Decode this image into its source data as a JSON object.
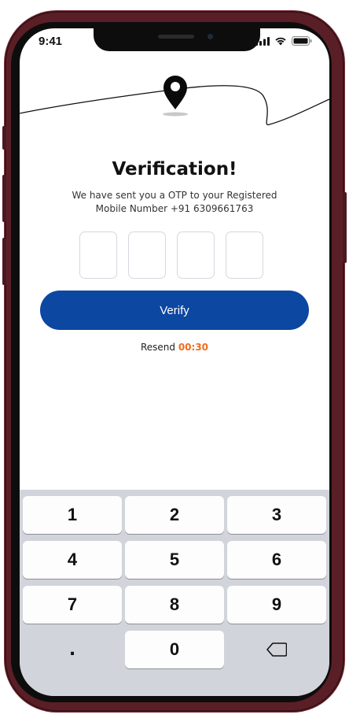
{
  "status_bar": {
    "time": "9:41"
  },
  "header": {
    "title": "Verification!",
    "subtitle_line1": "We have sent you a OTP to your Registered",
    "subtitle_line2": "Mobile Number +91 6309661763"
  },
  "otp": {
    "digits": [
      "",
      "",
      "",
      ""
    ]
  },
  "actions": {
    "verify_label": "Verify",
    "resend_label": "Resend",
    "resend_timer": "00:30"
  },
  "keypad": {
    "keys": [
      "1",
      "2",
      "3",
      "4",
      "5",
      "6",
      "7",
      "8",
      "9",
      "0"
    ],
    "dot": "."
  },
  "icons": {
    "location_pin": "map-pin-icon",
    "backspace": "backspace-icon",
    "signal": "signal-icon",
    "wifi": "wifi-icon",
    "battery": "battery-icon"
  },
  "colors": {
    "primary": "#0c47a1",
    "timer": "#f26b1d",
    "keypad_bg": "#d1d4da"
  }
}
